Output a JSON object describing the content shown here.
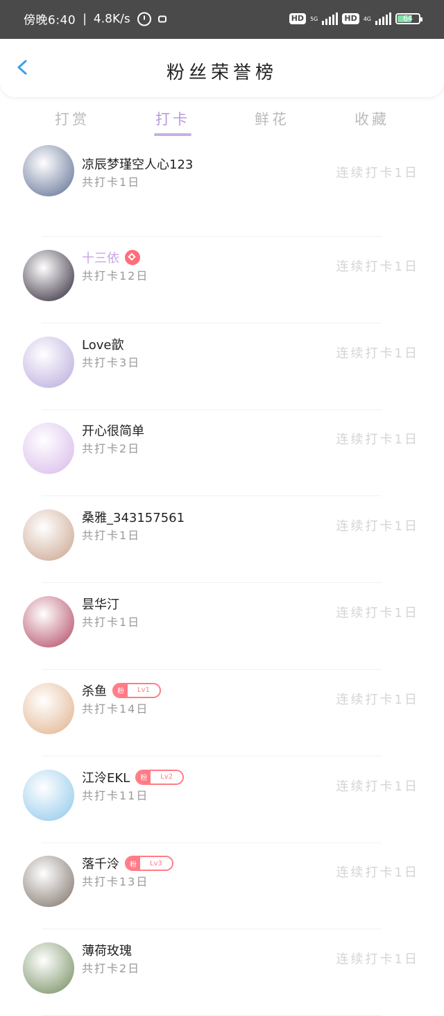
{
  "status_bar": {
    "time": "傍晚6:40",
    "speed": "4.8K/s",
    "hd1": "HD",
    "net1": "5G",
    "hd2": "HD",
    "net2": "4G",
    "battery": "64",
    "battery_level": 0.64
  },
  "header": {
    "title": "粉丝荣誉榜"
  },
  "tabs": [
    {
      "label": "打赏"
    },
    {
      "label": "打卡"
    },
    {
      "label": "鲜花"
    },
    {
      "label": "收藏"
    }
  ],
  "active_tab": 1,
  "rows": [
    {
      "name": "凉辰梦瑾空人心123",
      "sub": "共打卡1日",
      "streak": "连续打卡1日",
      "avatar_color": "#5a6a90"
    },
    {
      "name": "十三依",
      "sub": "共打卡12日",
      "streak": "连续打卡1日",
      "vip": true,
      "avatar_color": "#2b2233"
    },
    {
      "name": "Love歆",
      "sub": "共打卡3日",
      "streak": "连续打卡1日",
      "avatar_color": "#b7a8dc"
    },
    {
      "name": "开心很简单",
      "sub": "共打卡2日",
      "streak": "连续打卡1日",
      "avatar_color": "#d6b7ea"
    },
    {
      "name": "桑雅_343157561",
      "sub": "共打卡1日",
      "streak": "连续打卡1日",
      "avatar_color": "#c8a28a"
    },
    {
      "name": "昙华汀",
      "sub": "共打卡1日",
      "streak": "连续打卡1日",
      "avatar_color": "#b0445f"
    },
    {
      "name": "杀鱼",
      "sub": "共打卡14日",
      "streak": "连续打卡1日",
      "badge": {
        "tag": "粉",
        "level": "Lv1"
      },
      "avatar_color": "#e0b08a"
    },
    {
      "name": "江泠EKL",
      "sub": "共打卡11日",
      "streak": "连续打卡1日",
      "badge": {
        "tag": "粉",
        "level": "Lv2"
      },
      "avatar_color": "#8cc6ea"
    },
    {
      "name": "落千泠",
      "sub": "共打卡13日",
      "streak": "连续打卡1日",
      "badge": {
        "tag": "粉",
        "level": "Lv3"
      },
      "avatar_color": "#7a6e64"
    },
    {
      "name": "薄荷玫瑰",
      "sub": "共打卡2日",
      "streak": "连续打卡1日",
      "avatar_color": "#6f8a5a"
    }
  ],
  "colors": {
    "accent": "#b99ad8",
    "badge": "#ff7b86",
    "back": "#3aa0e8"
  }
}
